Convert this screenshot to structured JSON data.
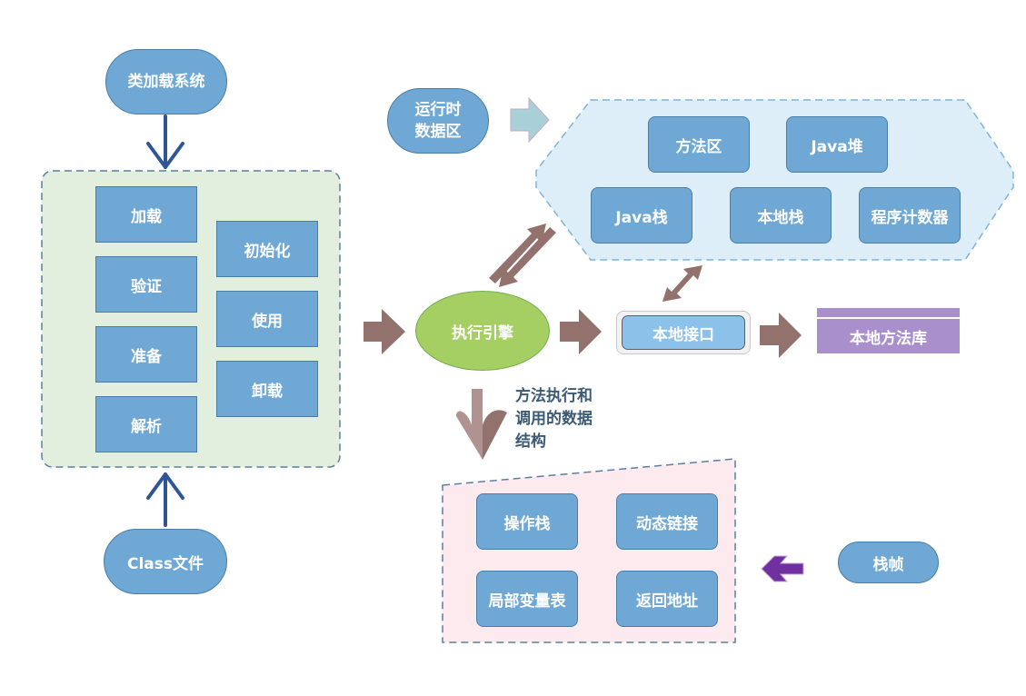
{
  "class_loader": {
    "title": "类加载系统",
    "stages_left": [
      "加载",
      "验证",
      "准备",
      "解析"
    ],
    "stages_right": [
      "初始化",
      "使用",
      "卸载"
    ],
    "input": "Class文件"
  },
  "runtime_data_area": {
    "title": "运行时数据区",
    "areas_top": [
      "方法区",
      "Java堆"
    ],
    "areas_bottom": [
      "Java栈",
      "本地栈",
      "程序计数器"
    ]
  },
  "execution_engine": "执行引擎",
  "native_interface": "本地接口",
  "native_library": "本地方法库",
  "stack_frame": {
    "caption": [
      "方法执行和",
      "调用的数据",
      "结构"
    ],
    "items": [
      "操作栈",
      "动态链接",
      "局部变量表",
      "返回地址"
    ],
    "label": "栈帧"
  },
  "colors": {
    "node_blue": "#6fa8d5",
    "loader_bg": "#e2efdf",
    "runtime_bg": "#ddeef8",
    "frame_bg": "#fdeaee",
    "engine_green": "#a5cf63",
    "interface_blue": "#8cc1ea",
    "library_purple": "#a98fcb",
    "arrow_brown": "#93716d",
    "arrow_navy": "#2f5597",
    "arrow_teal": "#a8d0d6",
    "arrow_purple": "#7030a0"
  }
}
